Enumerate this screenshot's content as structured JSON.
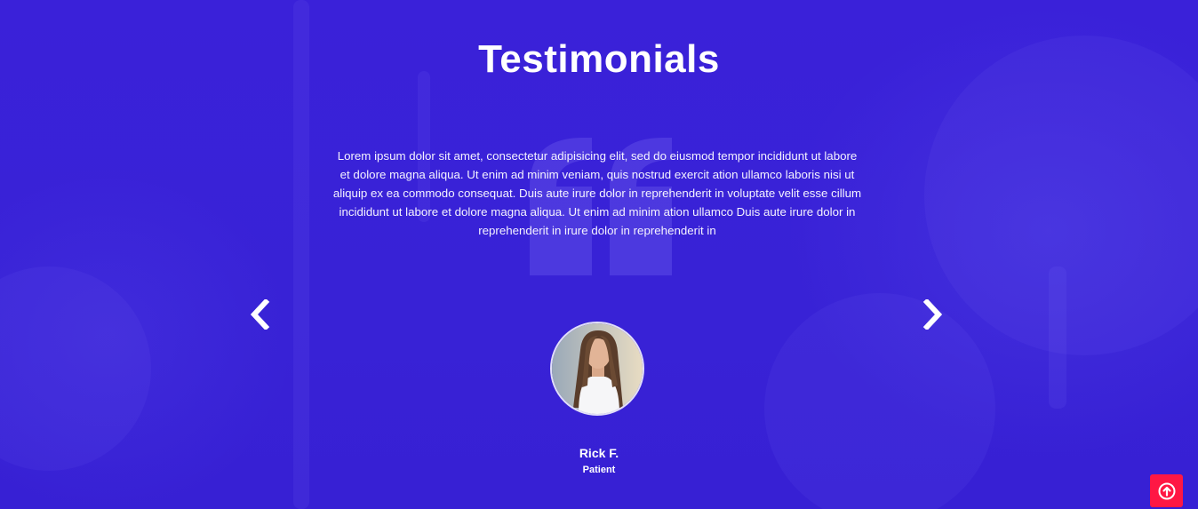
{
  "section": {
    "title": "Testimonials",
    "background_color": "#3a22d8"
  },
  "testimonial": {
    "text": "Lorem ipsum dolor sit amet, consectetur adipisicing elit, sed do eiusmod tempor incididunt ut labore et dolore magna aliqua. Ut enim ad minim veniam, quis nostrud exercit ation ullamco laboris nisi ut aliquip ex ea commodo consequat. Duis aute irure dolor in reprehenderit in voluptate velit esse cillum incididunt ut labore et dolore magna aliqua. Ut enim ad minim ation ullamco Duis aute irure dolor in reprehenderit in irure dolor in reprehenderit in",
    "name": "Rick F.",
    "role": "Patient"
  },
  "icons": {
    "prev": "chevron-left-icon",
    "next": "chevron-right-icon",
    "quote": "quote-icon",
    "scroll_top": "arrow-up-circle-icon"
  },
  "colors": {
    "accent": "#ff1744",
    "text": "#ffffff"
  }
}
